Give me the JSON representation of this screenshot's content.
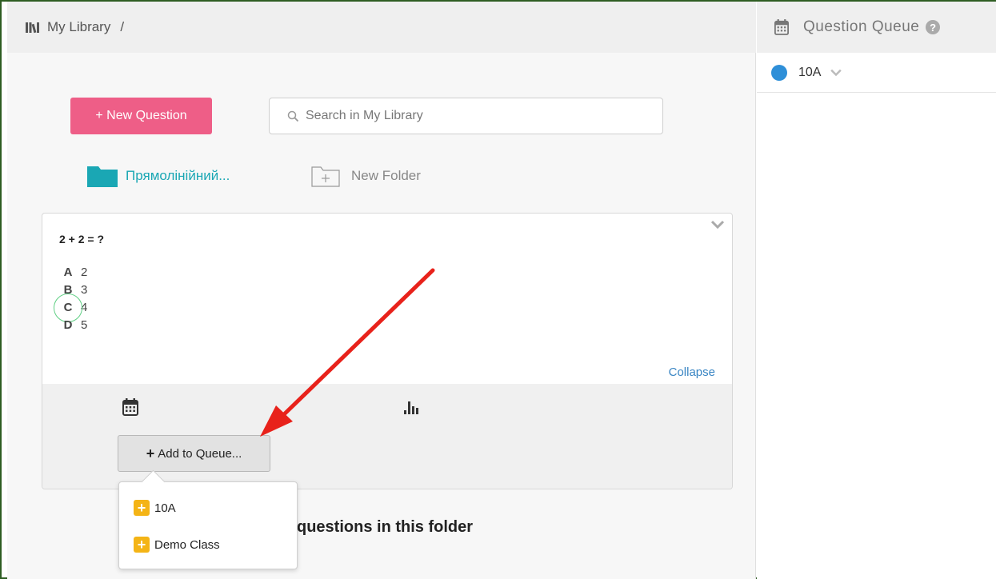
{
  "breadcrumb": {
    "title": "My Library",
    "separator": "/"
  },
  "toolbar": {
    "new_question_label": "+ New Question"
  },
  "search": {
    "placeholder": "Search in My Library"
  },
  "folders": [
    {
      "label": "Прямолінійний..."
    }
  ],
  "new_folder_label": "New Folder",
  "question": {
    "text": "2 + 2 = ?",
    "options": [
      {
        "letter": "A",
        "value": "2",
        "correct": false
      },
      {
        "letter": "B",
        "value": "3",
        "correct": false
      },
      {
        "letter": "C",
        "value": "4",
        "correct": true
      },
      {
        "letter": "D",
        "value": "5",
        "correct": false
      }
    ],
    "collapse_label": "Collapse",
    "add_to_queue_label": "Add to Queue..."
  },
  "queue_menu": {
    "items": [
      "10A",
      "Demo Class"
    ]
  },
  "empty_message": "questions in this folder",
  "queue_panel": {
    "title": "Question Queue",
    "help": "?",
    "classes": [
      {
        "name": "10A"
      }
    ]
  },
  "colors": {
    "accent_pink": "#ee5e87",
    "folder_teal": "#1aa7b4",
    "link_blue": "#3a86c4",
    "class_dot": "#2e8fd8",
    "menu_plus": "#f4b416"
  },
  "icons": [
    "library-icon",
    "search-icon",
    "folder-icon",
    "new-folder-icon",
    "chevron-down-icon",
    "calendar-icon",
    "bar-chart-icon",
    "plus-icon",
    "help-icon"
  ]
}
